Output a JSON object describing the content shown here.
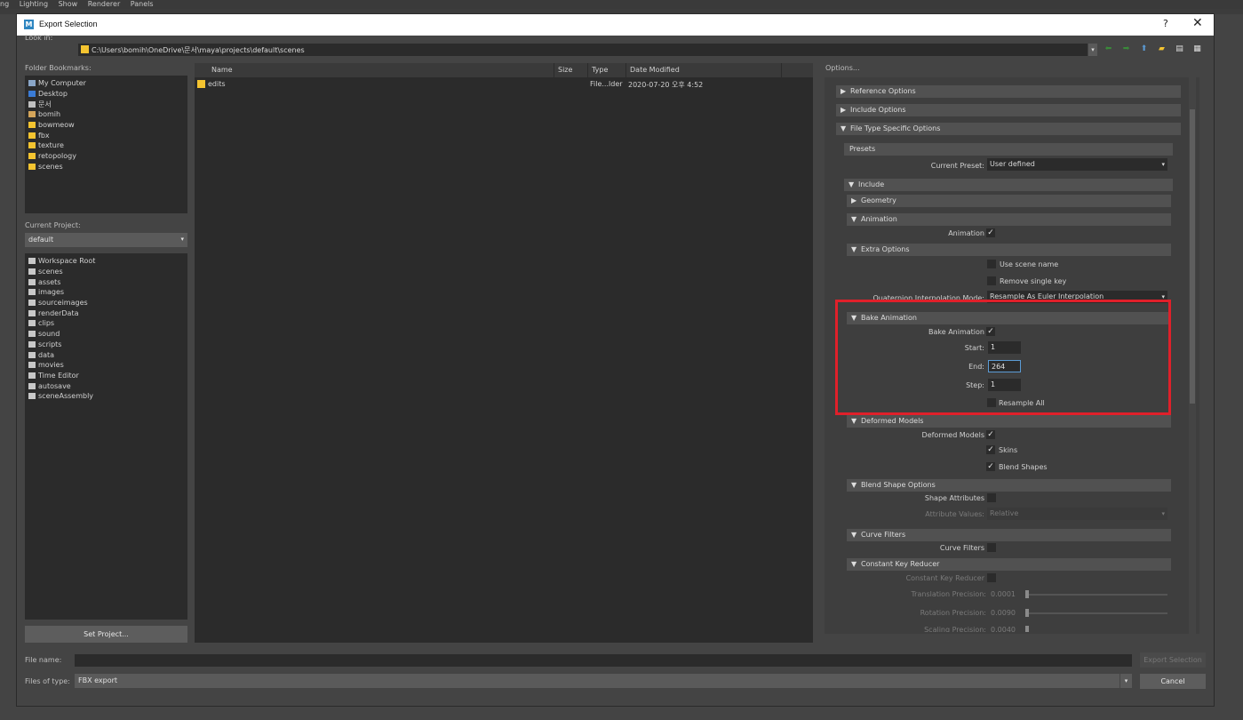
{
  "maya_menu": [
    "ng",
    "Lighting",
    "Show",
    "Renderer",
    "Panels"
  ],
  "dialog": {
    "title": "Export Selection",
    "help": "?",
    "close": "✕"
  },
  "lookin": {
    "label": "Look in:",
    "path": "C:\\Users\\bomih\\OneDrive\\문서\\maya\\projects\\default\\scenes"
  },
  "bookmarks": {
    "label": "Folder Bookmarks:",
    "items": [
      "My Computer",
      "Desktop",
      "문서",
      "bomih",
      "bowmeow",
      "fbx",
      "texture",
      "retopology",
      "scenes"
    ]
  },
  "project": {
    "label": "Current Project:",
    "value": "default",
    "tree": [
      "Workspace Root",
      "scenes",
      "assets",
      "images",
      "sourceimages",
      "renderData",
      "clips",
      "sound",
      "scripts",
      "data",
      "movies",
      "Time Editor",
      "autosave",
      "sceneAssembly"
    ],
    "set_button": "Set Project..."
  },
  "filelist": {
    "headers": [
      "Name",
      "Size",
      "Type",
      "Date Modified"
    ],
    "rows": [
      {
        "name": "edits",
        "size": "",
        "type": "File...lder",
        "date": "2020-07-20 오후 4:52"
      }
    ]
  },
  "options": {
    "label": "Options...",
    "frames": {
      "reference": "Reference Options",
      "include_opts": "Include Options",
      "file_type": "File Type Specific Options",
      "presets": "Presets",
      "include": "Include",
      "geometry": "Geometry",
      "animation": "Animation",
      "extra": "Extra Options",
      "bake": "Bake Animation",
      "deformed": "Deformed Models",
      "blend": "Blend Shape Options",
      "curve": "Curve Filters",
      "constant": "Constant Key Reducer"
    },
    "current_preset_label": "Current Preset:",
    "current_preset_value": "User defined",
    "animation_label": "Animation",
    "use_scene_name": "Use scene name",
    "remove_single_key": "Remove single key",
    "quaternion_label": "Quaternion Interpolation Mode:",
    "quaternion_value": "Resample As Euler Interpolation",
    "bake_animation_label": "Bake Animation",
    "start_label": "Start:",
    "start_value": "1",
    "end_label": "End:",
    "end_value": "264",
    "step_label": "Step:",
    "step_value": "1",
    "resample_all": "Resample All",
    "deformed_models_label": "Deformed Models",
    "skins": "Skins",
    "blend_shapes": "Blend Shapes",
    "shape_attributes": "Shape Attributes",
    "attribute_values_label": "Attribute Values:",
    "attribute_values_value": "Relative",
    "curve_filters_label": "Curve Filters",
    "constant_key_reducer_label": "Constant Key Reducer",
    "translation_precision_label": "Translation Precision:",
    "translation_precision_value": "0.0001",
    "rotation_precision_label": "Rotation Precision:",
    "rotation_precision_value": "0.0090",
    "scaling_precision_label": "Scaling Precision:",
    "scaling_precision_value": "0.0040",
    "checked_mark": "✓"
  },
  "footer": {
    "filename_label": "File name:",
    "filename_value": "",
    "filetype_label": "Files of type:",
    "filetype_value": "FBX export",
    "export_button": "Export Selection",
    "cancel_button": "Cancel"
  },
  "colors": {
    "highlight": "#e0202a",
    "folder": "#f4c430",
    "maya_blue": "#2e86c1"
  }
}
